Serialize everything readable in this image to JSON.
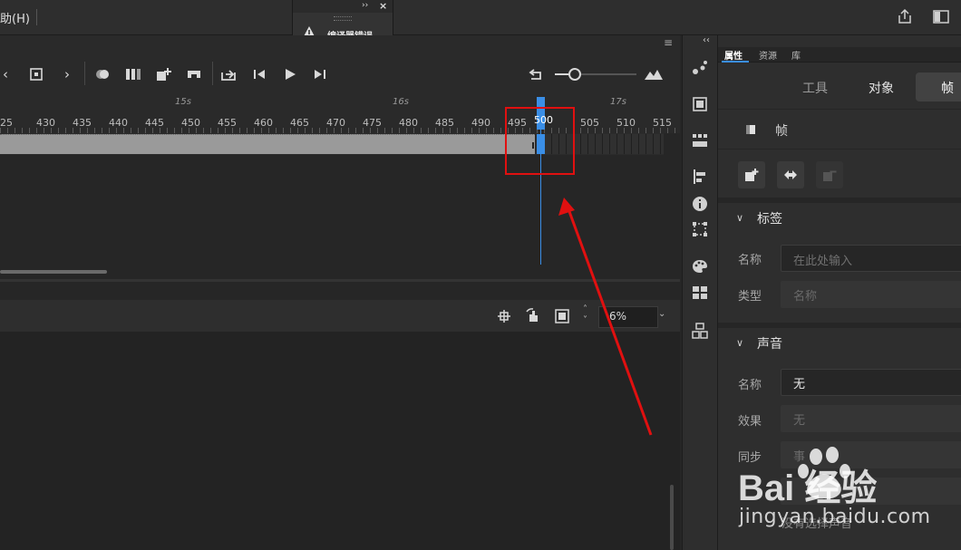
{
  "menu": {
    "help": "助(H)"
  },
  "error_panel": {
    "title": "编译器错误"
  },
  "timeline": {
    "second_labels": [
      "15s",
      "16s",
      "17s"
    ],
    "frame_labels": [
      "25",
      "430",
      "435",
      "440",
      "445",
      "450",
      "455",
      "460",
      "465",
      "470",
      "475",
      "480",
      "485",
      "490",
      "495",
      "500",
      "505",
      "510",
      "515"
    ],
    "current_frame": 500,
    "zoom": "6%"
  },
  "properties": {
    "tabs": [
      "属性",
      "资源",
      "库"
    ],
    "active_tab": "属性",
    "segments": [
      "工具",
      "对象",
      "帧"
    ],
    "active_segment": "帧",
    "frame_row_label": "帧",
    "label_section": {
      "title": "标签",
      "name_label": "名称",
      "name_placeholder": "在此处输入",
      "type_label": "类型",
      "type_value": "名称"
    },
    "sound_section": {
      "title": "声音",
      "name_label": "名称",
      "name_value": "无",
      "effect_label": "效果",
      "effect_value": "无",
      "sync_label": "同步",
      "sync_value": "事",
      "note": "没有选择声音"
    }
  },
  "watermark": {
    "brand": "Bai 经验",
    "url": "jingyan.baidu.com"
  },
  "colors": {
    "playhead": "#3a8ee6",
    "annotation": "#e01010",
    "panel": "#2e2e2e"
  }
}
